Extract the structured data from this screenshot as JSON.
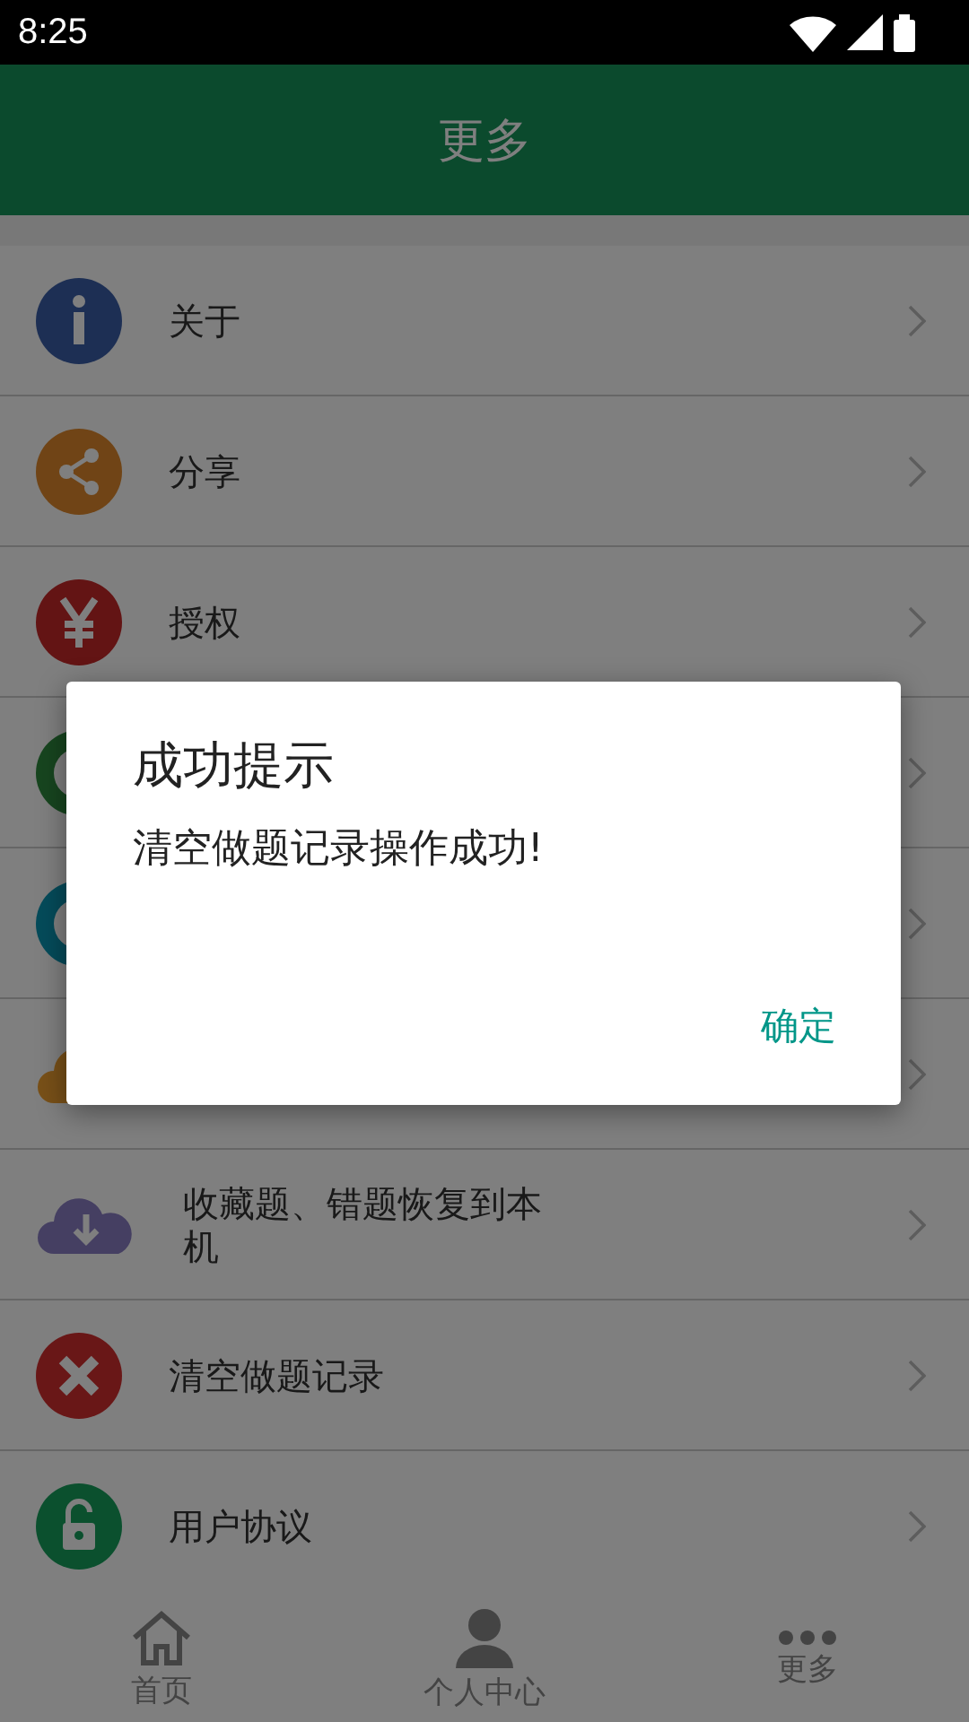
{
  "status_bar": {
    "time": "8:25"
  },
  "header": {
    "title": "更多"
  },
  "rows": [
    {
      "label": "关于"
    },
    {
      "label": "分享"
    },
    {
      "label": "授权"
    },
    {},
    {},
    {},
    {
      "label": "收藏题、错题恢复到本机"
    },
    {
      "label": "清空做题记录"
    },
    {
      "label": "用户协议"
    }
  ],
  "bottom_nav": [
    {
      "label": "首页"
    },
    {
      "label": "个人中心"
    },
    {
      "label": "更多"
    }
  ],
  "dialog": {
    "title": "成功提示",
    "message": "清空做题记录操作成功!",
    "button": "确定"
  }
}
